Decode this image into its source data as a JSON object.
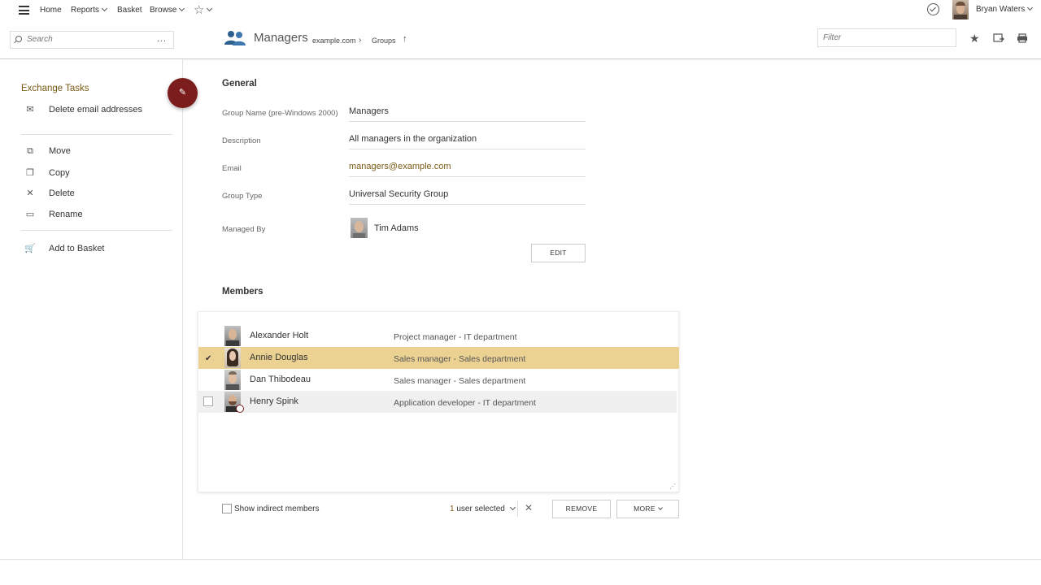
{
  "topnav": {
    "home": "Home",
    "reports": "Reports",
    "basket": "Basket",
    "browse": "Browse",
    "user_name": "Bryan Waters"
  },
  "search": {
    "placeholder": "Search",
    "more": "..."
  },
  "header": {
    "title": "Managers",
    "breadcrumb": [
      "example.com",
      "Groups"
    ],
    "filter_placeholder": "Filter"
  },
  "sidebar": {
    "section_title": "Exchange Tasks",
    "exchange_items": [
      {
        "label": "Delete email addresses",
        "icon": "email-delete-icon"
      }
    ],
    "items": [
      {
        "label": "Move",
        "icon": "move-icon"
      },
      {
        "label": "Copy",
        "icon": "copy-icon"
      },
      {
        "label": "Delete",
        "icon": "delete-icon"
      },
      {
        "label": "Rename",
        "icon": "rename-icon"
      }
    ],
    "basket_item": {
      "label": "Add to Basket",
      "icon": "basket-icon"
    }
  },
  "general": {
    "title": "General",
    "fields": [
      {
        "label": "Group Name (pre-Windows 2000)",
        "value": "Managers"
      },
      {
        "label": "Description",
        "value": "All managers in the organization"
      },
      {
        "label": "Email",
        "value": "managers@example.com"
      },
      {
        "label": "Group Type",
        "value": "Universal Security Group"
      }
    ],
    "managed_by_label": "Managed By",
    "managed_by_value": "Tim Adams",
    "edit_label": "EDIT"
  },
  "members": {
    "title": "Members",
    "rows": [
      {
        "name": "Alexander Holt",
        "description": "Project manager - IT department",
        "selected": false
      },
      {
        "name": "Annie Douglas",
        "description": "Sales manager - Sales department",
        "selected": true
      },
      {
        "name": "Dan Thibodeau",
        "description": "Sales manager - Sales department",
        "selected": false
      },
      {
        "name": "Henry Spink",
        "description": "Application developer - IT department",
        "selected": false
      }
    ],
    "show_indirect_label": "Show indirect members",
    "selected_count": "1",
    "selected_suffix": "user selected",
    "remove_label": "REMOVE",
    "more_label": "MORE"
  },
  "colors": {
    "accent": "#7a5a16",
    "selection": "#ebd192",
    "fab": "#7c1d1d"
  }
}
